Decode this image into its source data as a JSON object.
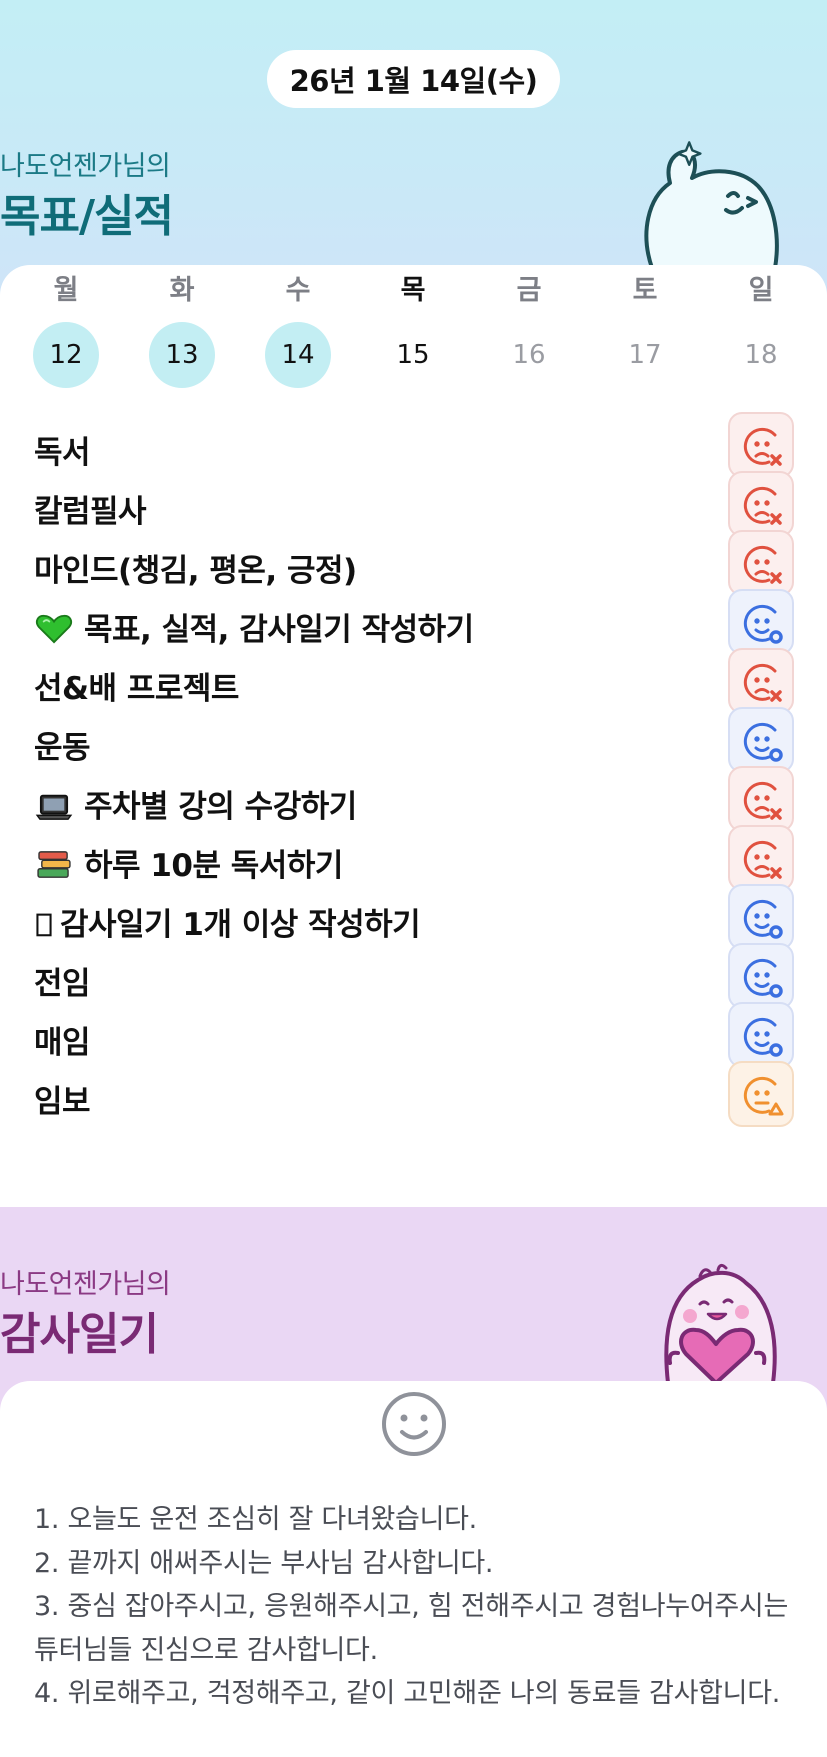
{
  "header": {
    "date": "26년 1월 14일(수)"
  },
  "goals_section": {
    "owner": "나도언젠가님의",
    "title": "목표/실적"
  },
  "week": {
    "days": [
      "월",
      "화",
      "수",
      "목",
      "금",
      "토",
      "일"
    ],
    "dates": [
      "12",
      "13",
      "14",
      "15",
      "16",
      "17",
      "18"
    ],
    "today_index": 3,
    "completed_indices": [
      0,
      1,
      2
    ]
  },
  "goals": [
    {
      "label": "독서",
      "icon": "",
      "status": "fail"
    },
    {
      "label": "칼럼필사",
      "icon": "",
      "status": "fail"
    },
    {
      "label": "마인드(챙김, 평온, 긍정)",
      "icon": "",
      "status": "fail"
    },
    {
      "label": "목표, 실적, 감사일기 작성하기",
      "icon": "green-heart",
      "status": "success"
    },
    {
      "label": "선&배 프로젝트",
      "icon": "",
      "status": "fail"
    },
    {
      "label": "운동",
      "icon": "",
      "status": "success"
    },
    {
      "label": "주차별 강의 수강하기",
      "icon": "laptop",
      "status": "fail"
    },
    {
      "label": "하루 10분 독서하기",
      "icon": "books",
      "status": "fail"
    },
    {
      "label": "감사일기 1개 이상 작성하기",
      "icon": "missing-glyph",
      "status": "success"
    },
    {
      "label": "전임",
      "icon": "",
      "status": "success"
    },
    {
      "label": "매임",
      "icon": "",
      "status": "success"
    },
    {
      "label": "임보",
      "icon": "",
      "status": "partial"
    }
  ],
  "colors": {
    "fail": "#e0513f",
    "success": "#3b6fe0",
    "partial": "#f0902f",
    "top_bg": "#c3eef5",
    "bottom_bg": "#ead7f4",
    "done_circle": "#c3eef3"
  },
  "gratitude_section": {
    "owner": "나도언젠가님의",
    "title": "감사일기",
    "lines": [
      "1. 오늘도 운전 조심히 잘 다녀왔습니다.",
      "2. 끝까지 애써주시는 부사님 감사합니다.",
      "3. 중심 잡아주시고, 응원해주시고, 힘 전해주시고 경험나누어주시는 튜터님들 진심으로 감사합니다.",
      "4. 위로해주고, 걱정해주고, 같이 고민해준 나의 동료들 감사합니다."
    ]
  }
}
